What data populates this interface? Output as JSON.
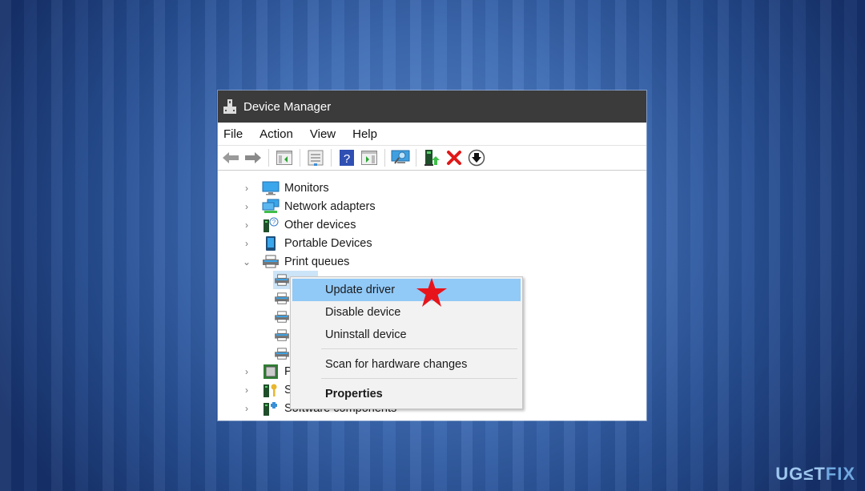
{
  "window": {
    "title": "Device Manager"
  },
  "menubar": {
    "items": [
      "File",
      "Action",
      "View",
      "Help"
    ]
  },
  "toolbar": {
    "buttons": [
      {
        "icon": "back-arrow-icon"
      },
      {
        "icon": "forward-arrow-icon"
      },
      {
        "icon": "show-hide-console-tree-icon"
      },
      {
        "icon": "properties-icon"
      },
      {
        "icon": "help-icon"
      },
      {
        "icon": "show-action-pane-icon"
      },
      {
        "icon": "scan-hardware-icon"
      },
      {
        "icon": "update-driver-icon"
      },
      {
        "icon": "uninstall-icon"
      },
      {
        "icon": "enable-device-icon"
      }
    ]
  },
  "tree": {
    "items": [
      {
        "label": "Monitors",
        "expanded": false,
        "icon": "monitor-icon"
      },
      {
        "label": "Network adapters",
        "expanded": false,
        "icon": "network-adapter-icon"
      },
      {
        "label": "Other devices",
        "expanded": false,
        "icon": "other-devices-icon"
      },
      {
        "label": "Portable Devices",
        "expanded": false,
        "icon": "portable-device-icon"
      },
      {
        "label": "Print queues",
        "expanded": true,
        "icon": "printer-icon"
      },
      {
        "label": "Pr",
        "expanded": false,
        "icon": "processor-icon"
      },
      {
        "label": "Se",
        "expanded": false,
        "icon": "security-device-icon"
      },
      {
        "label": "Software components",
        "expanded": false,
        "icon": "software-component-icon"
      }
    ],
    "print_queue_children": 5
  },
  "context_menu": {
    "items": [
      {
        "label": "Update driver",
        "highlighted": true
      },
      {
        "label": "Disable device"
      },
      {
        "label": "Uninstall device"
      },
      {
        "label": "Scan for hardware changes"
      },
      {
        "label": "Properties",
        "bold": true
      }
    ]
  },
  "annotation": {
    "marker": "red-star",
    "color": "#e8141b"
  },
  "watermark": {
    "part1": "UG",
    "part2": "≤",
    "part3": "T",
    "part4": "FIX"
  },
  "colors": {
    "titlebar": "#3b3b3b",
    "highlight": "#91c9f7",
    "background_blue": "#3f6db5"
  }
}
